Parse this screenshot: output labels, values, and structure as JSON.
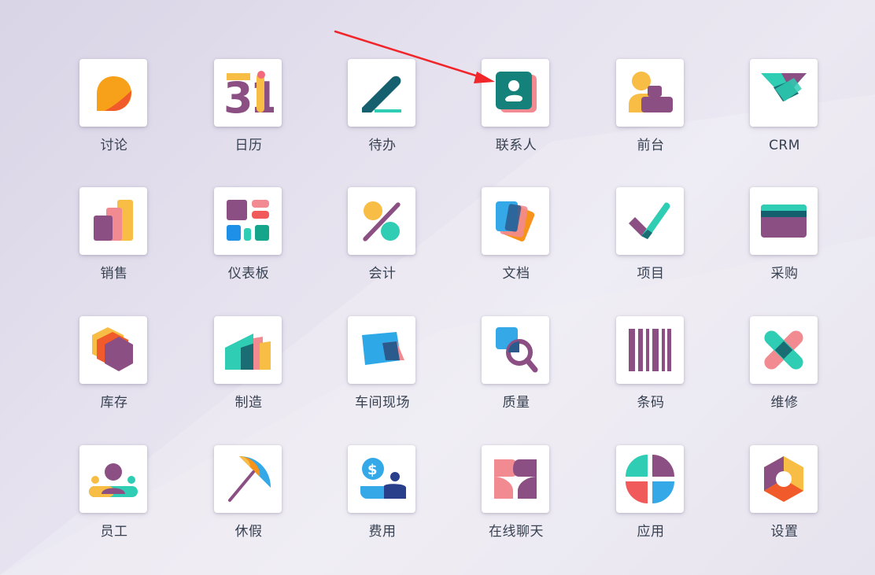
{
  "apps": [
    {
      "label": "讨论",
      "icon": "discuss-icon"
    },
    {
      "label": "日历",
      "icon": "calendar-icon"
    },
    {
      "label": "待办",
      "icon": "todo-icon"
    },
    {
      "label": "联系人",
      "icon": "contacts-icon"
    },
    {
      "label": "前台",
      "icon": "frontdesk-icon"
    },
    {
      "label": "CRM",
      "icon": "crm-icon"
    },
    {
      "label": "销售",
      "icon": "sales-icon"
    },
    {
      "label": "仪表板",
      "icon": "dashboard-icon"
    },
    {
      "label": "会计",
      "icon": "accounting-icon"
    },
    {
      "label": "文档",
      "icon": "documents-icon"
    },
    {
      "label": "项目",
      "icon": "project-icon"
    },
    {
      "label": "采购",
      "icon": "purchase-icon"
    },
    {
      "label": "库存",
      "icon": "inventory-icon"
    },
    {
      "label": "制造",
      "icon": "manufacturing-icon"
    },
    {
      "label": "车间现场",
      "icon": "shopfloor-icon"
    },
    {
      "label": "质量",
      "icon": "quality-icon"
    },
    {
      "label": "条码",
      "icon": "barcode-icon"
    },
    {
      "label": "维修",
      "icon": "maintenance-icon"
    },
    {
      "label": "员工",
      "icon": "employees-icon"
    },
    {
      "label": "休假",
      "icon": "timeoff-icon"
    },
    {
      "label": "费用",
      "icon": "expenses-icon"
    },
    {
      "label": "在线聊天",
      "icon": "livechat-icon"
    },
    {
      "label": "应用",
      "icon": "apps-icon"
    },
    {
      "label": "设置",
      "icon": "settings-icon"
    }
  ],
  "calendar_day": "31",
  "colors": {
    "arrow": "#f0262b",
    "label": "#374151",
    "tile": "#ffffff"
  }
}
